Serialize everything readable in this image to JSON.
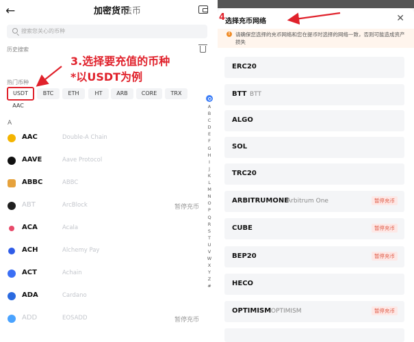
{
  "left": {
    "tabs": {
      "active": "加密货币",
      "inactive": "法币"
    },
    "search_placeholder": "搜索您关心的币种",
    "history_label": "历史搜索",
    "hot_label": "热门币种",
    "hot_chips": [
      "USDT",
      "BTC",
      "ETH",
      "HT",
      "ARB",
      "CORE",
      "TRX",
      "AAC"
    ],
    "section_letter": "A",
    "status_paused": "暂停充币",
    "rows": [
      {
        "symbol": "AAC",
        "name": "Double-A Chain",
        "status": "",
        "icon_color": "#f4b400",
        "dim": false
      },
      {
        "symbol": "AAVE",
        "name": "Aave Protocol",
        "status": "",
        "icon_color": "#111111",
        "dim": false
      },
      {
        "symbol": "ABBC",
        "name": "ABBC",
        "status": "",
        "icon_color": "#e6a23c",
        "dim": false
      },
      {
        "symbol": "ABT",
        "name": "ArcBlock",
        "status": "暂停充币",
        "icon_color": "#1f1f1f",
        "dim": true
      },
      {
        "symbol": "ACA",
        "name": "Acala",
        "status": "",
        "icon_color": "#e84a6a",
        "dim": false
      },
      {
        "symbol": "ACH",
        "name": "Alchemy Pay",
        "status": "",
        "icon_color": "#2f5ce8",
        "dim": false
      },
      {
        "symbol": "ACT",
        "name": "Achain",
        "status": "",
        "icon_color": "#3b6ff5",
        "dim": false
      },
      {
        "symbol": "ADA",
        "name": "Cardano",
        "status": "",
        "icon_color": "#2a6ae0",
        "dim": false
      },
      {
        "symbol": "ADD",
        "name": "EOSADD",
        "status": "暂停充币",
        "icon_color": "#4aa3ff",
        "dim": true
      }
    ],
    "index_letters": [
      "A",
      "B",
      "C",
      "D",
      "E",
      "F",
      "G",
      "H",
      "I",
      "J",
      "K",
      "L",
      "M",
      "N",
      "O",
      "P",
      "Q",
      "R",
      "S",
      "T",
      "U",
      "V",
      "W",
      "X",
      "Y",
      "Z",
      "#"
    ],
    "annotation_line1": "3.选择要充值的币种",
    "annotation_line2": "*以USDT为例"
  },
  "right": {
    "title": "选择充币网络",
    "step_number": "4",
    "notice": "请确保您选择的充币网络和您在提币时选择的网络一致，否则可能造成资产损失",
    "networks": [
      {
        "name": "ERC20",
        "sub": "",
        "badge": ""
      },
      {
        "name": "BTT",
        "sub": "BTT",
        "badge": ""
      },
      {
        "name": "ALGO",
        "sub": "",
        "badge": ""
      },
      {
        "name": "SOL",
        "sub": "",
        "badge": ""
      },
      {
        "name": "TRC20",
        "sub": "",
        "badge": ""
      },
      {
        "name": "ARBITRUMONE",
        "sub": "Arbitrum One",
        "badge": "暂停充币"
      },
      {
        "name": "CUBE",
        "sub": "",
        "badge": "暂停充币"
      },
      {
        "name": "BEP20",
        "sub": "",
        "badge": "暂停充币"
      },
      {
        "name": "HECO",
        "sub": "",
        "badge": ""
      },
      {
        "name": "OPTIMISM",
        "sub": "OPTIMISM",
        "badge": "暂停充币"
      }
    ]
  },
  "colors": {
    "annotation_red": "#e0212b",
    "accent_blue": "#3d7ef7",
    "paused_badge_bg": "#fde8e6",
    "paused_badge_text": "#e05a45"
  },
  "icons": [
    "back-arrow-icon",
    "wallet-icon",
    "search-icon",
    "trash-icon",
    "close-icon",
    "warning-icon"
  ]
}
